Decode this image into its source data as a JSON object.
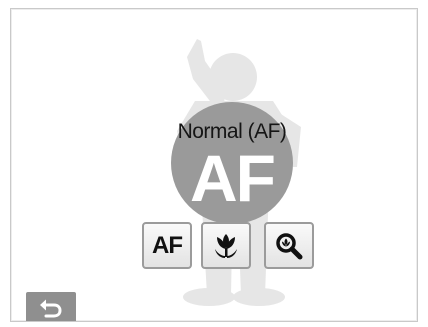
{
  "focus_mode": {
    "current_name": "Normal (AF)",
    "current_glyph": "AF"
  },
  "options": [
    {
      "label": "AF",
      "icon": "af-text-icon"
    },
    {
      "label": "",
      "icon": "macro-flower-icon"
    },
    {
      "label": "",
      "icon": "auto-macro-magnifier-icon"
    }
  ],
  "back_button": {
    "icon": "back-arrow-icon"
  },
  "colors": {
    "disc": "#9a9a9a",
    "silhouette": "#e6e6e6",
    "button_border": "#9b9b9b",
    "back_button": "#8f8f8f"
  }
}
